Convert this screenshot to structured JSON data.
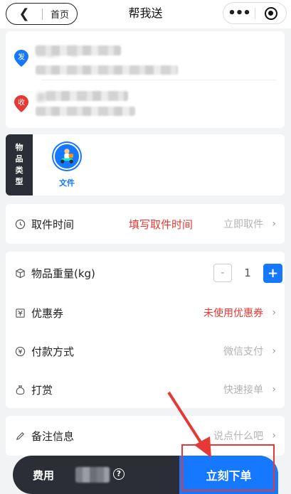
{
  "topbar": {
    "back_glyph": "❮",
    "home_label": "首页",
    "title": "帮我送",
    "more_glyph": "•••"
  },
  "address": {
    "send_badge": "发",
    "recv_badge": "收",
    "send_line1": "铁尘广场",
    "recv_line1": "谢",
    "colors": {
      "send_pin": "#1677ff",
      "recv_pin": "#e53935"
    }
  },
  "goods": {
    "tag_chars": [
      "物",
      "品",
      "类",
      "型"
    ],
    "items": [
      {
        "label": "文件",
        "icon": "courier-scooter-icon",
        "selected": true
      }
    ]
  },
  "pickup": {
    "label": "取件时间",
    "annotation": "填写取件时间",
    "value": "立即取件",
    "icon": "clock-icon"
  },
  "options": {
    "weight": {
      "label": "物品重量(kg)",
      "value": "1",
      "minus": "-",
      "plus": "+",
      "icon": "cube-icon"
    },
    "coupon": {
      "label": "优惠券",
      "value": "未使用优惠券",
      "icon": "coupon-icon"
    },
    "payment": {
      "label": "付款方式",
      "value": "微信支付",
      "icon": "payment-icon"
    },
    "tip": {
      "label": "打赏",
      "value": "快速接单",
      "icon": "money-bag-icon"
    }
  },
  "remark": {
    "label": "备注信息",
    "placeholder": "说点什么吧",
    "icon": "pen-icon"
  },
  "bottom": {
    "fee_label": "费用",
    "help_glyph": "?",
    "order_label": "立刻下单"
  },
  "chevron": "›",
  "colors": {
    "accent": "#1677ff",
    "highlight": "#e53935",
    "dark": "#2b2e36"
  }
}
